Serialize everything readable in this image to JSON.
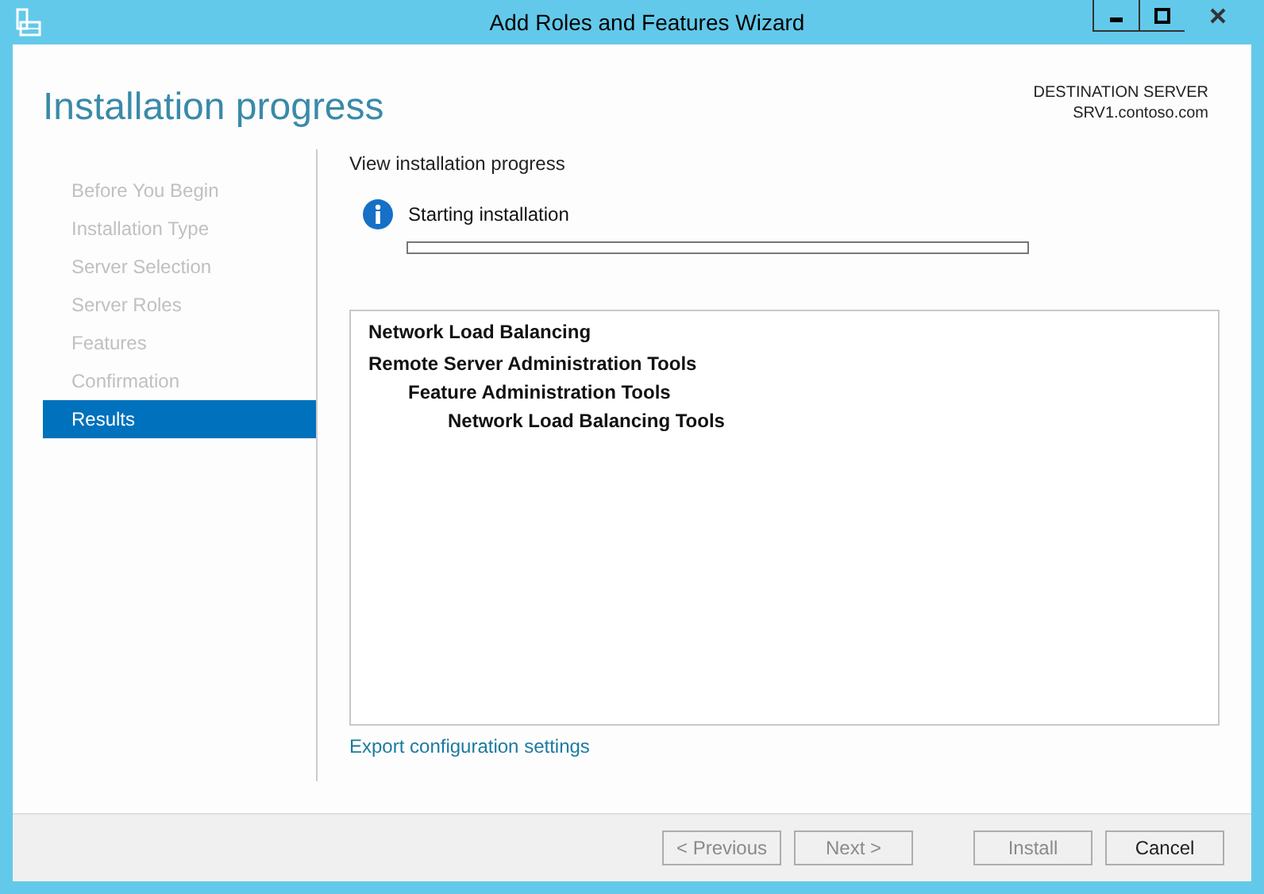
{
  "window": {
    "title": "Add Roles and Features Wizard"
  },
  "header": {
    "title": "Installation progress",
    "destination_label": "DESTINATION SERVER",
    "destination_server": "SRV1.contoso.com"
  },
  "steps": [
    {
      "label": "Before You Begin",
      "selected": false
    },
    {
      "label": "Installation Type",
      "selected": false
    },
    {
      "label": "Server Selection",
      "selected": false
    },
    {
      "label": "Server Roles",
      "selected": false
    },
    {
      "label": "Features",
      "selected": false
    },
    {
      "label": "Confirmation",
      "selected": false
    },
    {
      "label": "Results",
      "selected": true
    }
  ],
  "content": {
    "heading": "View installation progress",
    "status": "Starting installation",
    "progress": {
      "level": 0
    },
    "features": [
      {
        "label": "Network Load Balancing"
      },
      {
        "label": "Remote Server Administration Tools",
        "children": [
          {
            "label": "Feature Administration Tools",
            "children": [
              {
                "label": "Network Load Balancing Tools"
              }
            ]
          }
        ]
      }
    ],
    "export_link": "Export configuration settings"
  },
  "buttons": [
    {
      "label": "< Previous",
      "disabled": true
    },
    {
      "label": "Next >",
      "disabled": true
    },
    {
      "label": "Install",
      "disabled": true
    },
    {
      "label": "Cancel",
      "disabled": false
    }
  ]
}
